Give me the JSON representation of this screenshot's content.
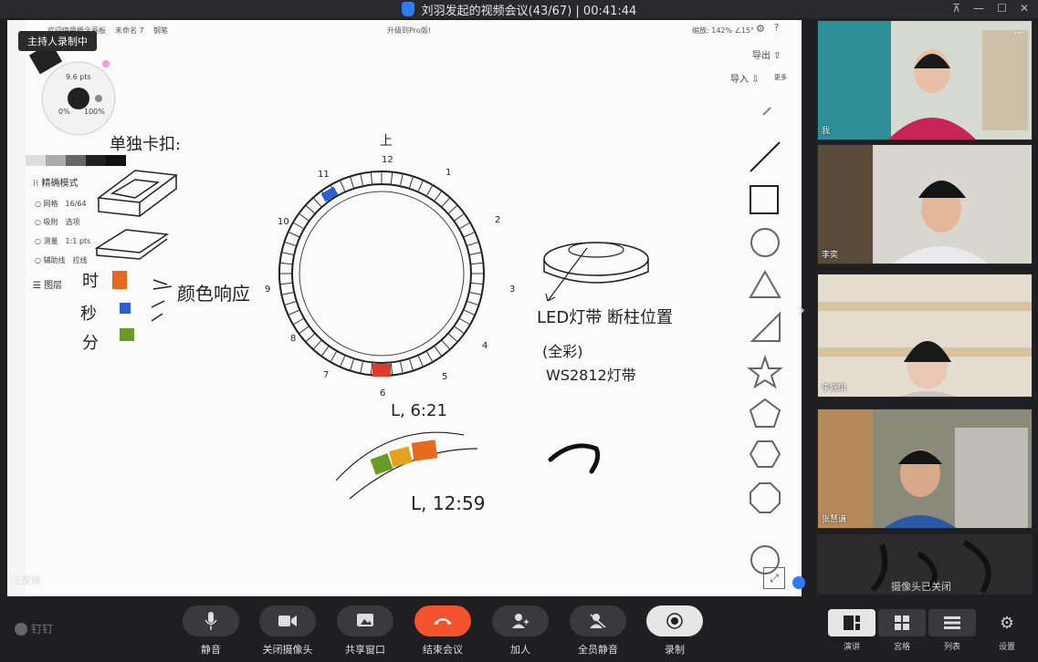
{
  "window": {
    "title": "刘羽发起的视频会议(43/67) | 00:41:44"
  },
  "whiteboard": {
    "recording_badge": "主持人录制中",
    "menu_1": "欢迎使用概念画板",
    "menu_2": "未命名 7",
    "menu_3": "钢笔",
    "upgrade": "升级到Pro版!",
    "zoom": "缩放: 142% ∠15°",
    "export_label": "导出",
    "import_label": "导入",
    "more_label": "更多",
    "brush_size": "9.6 pts",
    "opacity_min": "0%",
    "opacity_max": "100%",
    "precision_mode": "精确模式",
    "grid_label": "网格",
    "grid_value": "16/64",
    "snap_label": "吸附",
    "snap_value": "选项",
    "measure_label": "测量",
    "measure_value": "1:1 pts",
    "guide_label": "辅助线",
    "guide_value": "拉线",
    "layers_label": "图层"
  },
  "handwriting": {
    "title_left": "单独卡扣:",
    "hour": "时",
    "minute_sec": "秒",
    "minute": "分",
    "color_note": "颜色响应",
    "led_note": "LED灯带 断柱位置",
    "color_word": "(全彩)",
    "strip_model": "WS2812灯带",
    "time1": "L, 6:21",
    "time2": "L, 12:59",
    "clock_top": "上",
    "clock_12": "12",
    "clock_1": "1",
    "clock_2": "2",
    "clock_3": "3",
    "clock_4": "4",
    "clock_5": "5",
    "clock_6": "6",
    "clock_7": "7",
    "clock_8": "8",
    "clock_9": "9",
    "clock_10": "10",
    "clock_11": "11"
  },
  "participants": [
    {
      "name": "我",
      "wall": "#2e8f98",
      "shirt": "#c8245a",
      "skin": "#e8c0a6",
      "hair": "#1a1a1a"
    },
    {
      "name": "李奕",
      "wall": "#d9d5cf",
      "shirt": "#e9e9ec",
      "skin": "#e2b79a",
      "hair": "#151515"
    },
    {
      "name": "李婉琪",
      "wall": "#e4dccf",
      "shirt": "#c9c4bd",
      "skin": "#eac7b0",
      "hair": "#1a1a1a"
    },
    {
      "name": "张慧谦",
      "wall": "#8a8a7a",
      "shirt": "#2a5aa6",
      "skin": "#d9a98a",
      "hair": "#151515"
    }
  ],
  "camera_off_label": "摄像头已关闭",
  "presenter_name": "汪俊峰",
  "brand": "钉钉",
  "controls": {
    "mute": "静音",
    "camera_off": "关闭摄像头",
    "share_window": "共享窗口",
    "end_meeting": "结束会议",
    "add_person": "加人",
    "mute_all": "全员静音",
    "record": "录制"
  },
  "layouts": {
    "speaker": "演讲",
    "grid": "宫格",
    "list": "列表",
    "settings": "设置"
  },
  "colors": {
    "end_red": "#f2532d",
    "accent_blue": "#2f7cf6",
    "led_red": "#e23a2a",
    "led_blue": "#2b5fd0",
    "led_orange": "#e66a1e",
    "led_green": "#6a9b22"
  }
}
